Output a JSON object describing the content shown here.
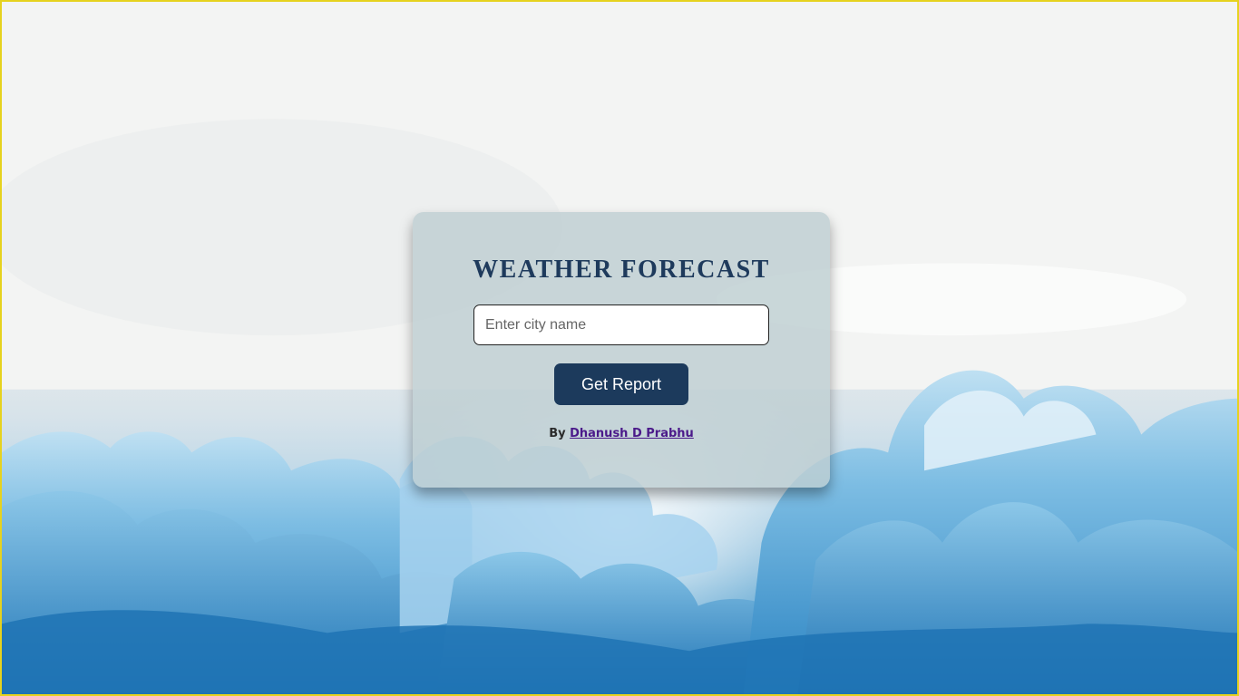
{
  "app": {
    "title": "WEATHER FORECAST"
  },
  "search": {
    "placeholder": "Enter city name",
    "value": ""
  },
  "actions": {
    "get_report_label": "Get Report"
  },
  "credit": {
    "prefix": "By",
    "author": "Dhanush D Prabhu"
  },
  "colors": {
    "accent": "#1c3a5c",
    "title": "#1e3a5c",
    "link": "#4b1a8a",
    "frame_border": "#e6d21e"
  }
}
